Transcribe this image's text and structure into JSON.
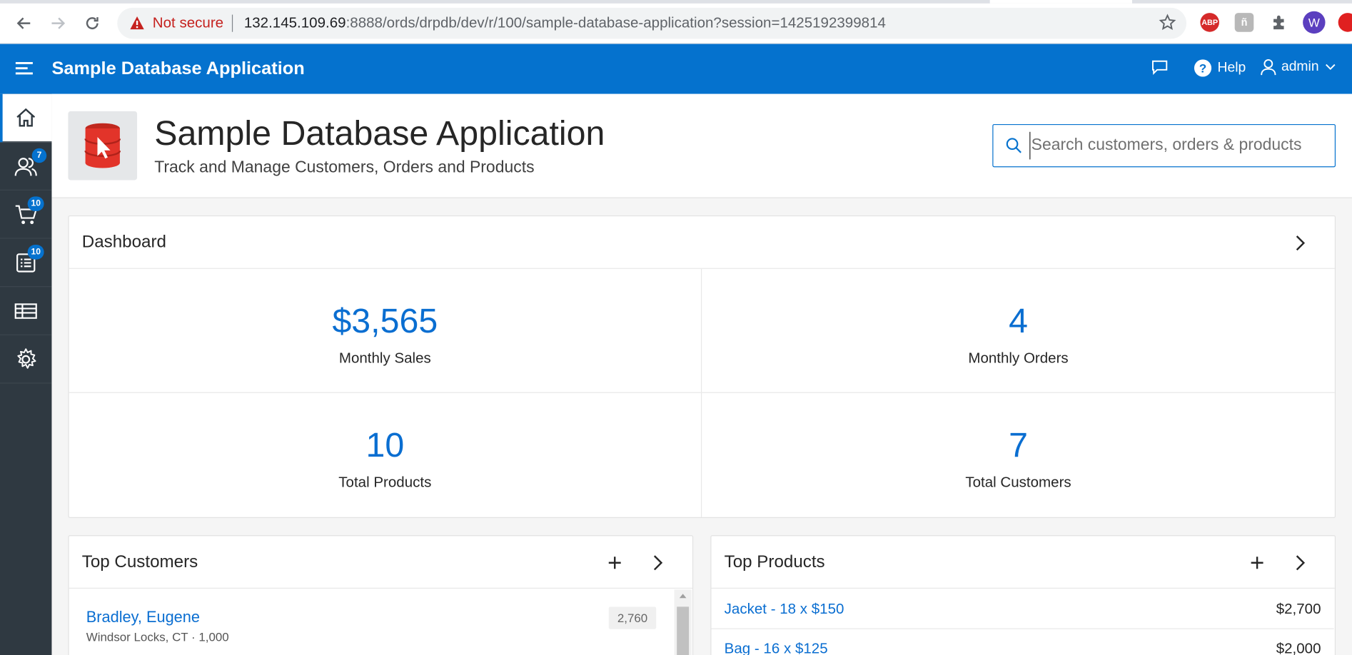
{
  "browser": {
    "not_secure": "Not secure",
    "url_host": "132.145.109.69",
    "url_rest": ":8888/ords/drpdb/dev/r/100/sample-database-application?session=1425192399814",
    "extensions": [
      "ABP",
      "ñ",
      "puzzle",
      "W"
    ]
  },
  "header": {
    "app_title": "Sample Database Application",
    "help_label": "Help",
    "user_label": "admin"
  },
  "sidebar": {
    "items": [
      {
        "name": "home",
        "badge": ""
      },
      {
        "name": "customers",
        "badge": "7"
      },
      {
        "name": "orders",
        "badge": "10"
      },
      {
        "name": "products",
        "badge": "10"
      },
      {
        "name": "reports",
        "badge": ""
      },
      {
        "name": "administration",
        "badge": ""
      }
    ]
  },
  "hero": {
    "title": "Sample Database Application",
    "subtitle": "Track and Manage Customers, Orders and Products",
    "search_placeholder": "Search customers, orders & products"
  },
  "dashboard": {
    "title": "Dashboard",
    "metrics": [
      {
        "value": "$3,565",
        "label": "Monthly Sales"
      },
      {
        "value": "4",
        "label": "Monthly Orders"
      },
      {
        "value": "10",
        "label": "Total Products"
      },
      {
        "value": "7",
        "label": "Total Customers"
      }
    ]
  },
  "top_customers": {
    "title": "Top Customers",
    "rows": [
      {
        "name": "Bradley, Eugene",
        "sub": "Windsor Locks, CT · 1,000",
        "amount": "2,760"
      }
    ]
  },
  "top_products": {
    "title": "Top Products",
    "rows": [
      {
        "name": "Jacket - 18 x $150",
        "amount": "$2,700"
      },
      {
        "name": "Bag - 16 x $125",
        "amount": "$2,000"
      }
    ]
  },
  "colors": {
    "brand": "#0572ce",
    "sidebar": "#2f3941",
    "link": "#0a6ed1"
  }
}
